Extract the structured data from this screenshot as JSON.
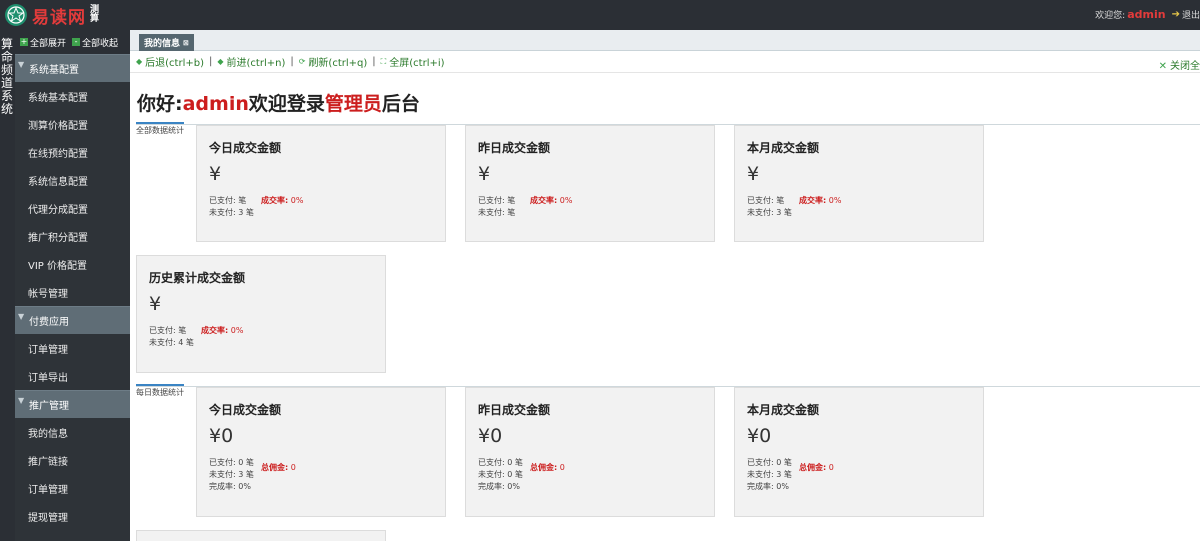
{
  "header": {
    "logo_text": "易读网",
    "logo_sub": "测算",
    "welcome_prefix": "欢迎您:",
    "username": "admin",
    "logout_label": "退出"
  },
  "rail": {
    "label": "算命频道系统"
  },
  "sidebar": {
    "expand_all": "全部展开",
    "collapse_all": "全部收起",
    "groups": [
      {
        "label": "系统基配置",
        "items": [
          "系统基本配置",
          "测算价格配置",
          "在线预约配置",
          "系统信息配置",
          "代理分成配置",
          "推广积分配置",
          "VIP 价格配置",
          "帐号管理"
        ]
      },
      {
        "label": "付费应用",
        "items": [
          "订单管理",
          "订单导出"
        ]
      },
      {
        "label": "推广管理",
        "items": [
          "我的信息",
          "推广链接",
          "订单管理",
          "提现管理"
        ]
      }
    ]
  },
  "tabs": [
    {
      "label": "我的信息"
    }
  ],
  "navbar": {
    "back": "后退(ctrl+b)",
    "forward": "前进(ctrl+n)",
    "refresh": "刷新(ctrl+q)",
    "fullscreen": "全屏(ctrl+i)",
    "close_all": "关闭全"
  },
  "welcome": {
    "hello": "你好:",
    "user": "admin",
    "mid": "欢迎登录",
    "role": "管理员",
    "suffix": "后台"
  },
  "sections": {
    "all": {
      "label": "全部数据统计",
      "cards": [
        {
          "title": "今日成交金额",
          "amount": "¥",
          "paid": "已支付: 笔",
          "unpaid": "未支付: 3 笔",
          "rate_label": "成交率:",
          "rate_value": "0%"
        },
        {
          "title": "昨日成交金额",
          "amount": "¥",
          "paid": "已支付: 笔",
          "unpaid": "未支付: 笔",
          "rate_label": "成交率:",
          "rate_value": "0%"
        },
        {
          "title": "本月成交金额",
          "amount": "¥",
          "paid": "已支付: 笔",
          "unpaid": "未支付: 3 笔",
          "rate_label": "成交率:",
          "rate_value": "0%"
        },
        {
          "title": "历史累计成交金额",
          "amount": "¥",
          "paid": "已支付: 笔",
          "unpaid": "未支付: 4 笔",
          "rate_label": "成交率:",
          "rate_value": "0%"
        }
      ]
    },
    "daily": {
      "label": "每日数据统计",
      "cards": [
        {
          "title": "今日成交金额",
          "amount": "¥0",
          "paid": "已支付: 0 笔",
          "unpaid": "未支付: 3 笔",
          "done": "完成率: 0%",
          "comm_label": "总佣金:",
          "comm_value": "0"
        },
        {
          "title": "昨日成交金额",
          "amount": "¥0",
          "paid": "已支付: 0 笔",
          "unpaid": "未支付: 0 笔",
          "done": "完成率: 0%",
          "comm_label": "总佣金:",
          "comm_value": "0"
        },
        {
          "title": "本月成交金额",
          "amount": "¥0",
          "paid": "已支付: 0 笔",
          "unpaid": "未支付: 3 笔",
          "done": "完成率: 0%",
          "comm_label": "总佣金:",
          "comm_value": "0"
        }
      ]
    }
  },
  "colors": {
    "accent_red": "#cc1e1e",
    "sidebar_bg": "#2e3338",
    "group_bg": "#5f6d76",
    "nav_green": "#3fa34d"
  }
}
